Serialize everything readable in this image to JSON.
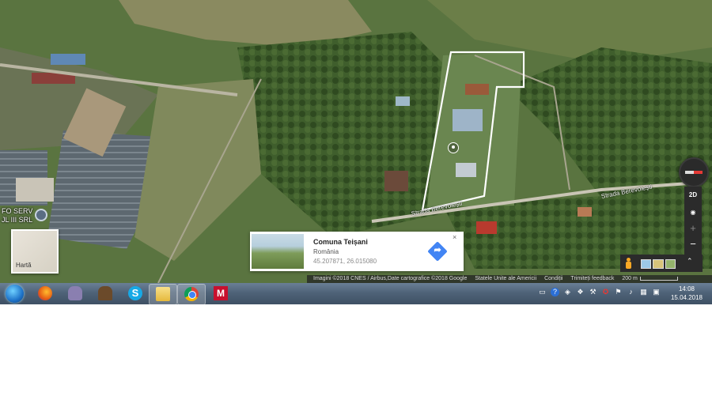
{
  "map": {
    "place_label_line1": "FO SERV",
    "place_label_line2": "JL III SRL",
    "street_1": "Strada Berevoiești",
    "street_2": "Strada Berevoiești",
    "map_type_label": "Hartă"
  },
  "info_card": {
    "title": "Comuna Teișani",
    "country": "România",
    "coordinates": "45.207871, 26.015080",
    "close_glyph": "×",
    "directions_glyph": "➦"
  },
  "controls": {
    "view_mode": "2D",
    "zoom_in": "+",
    "zoom_out": "−",
    "expand": "⌃"
  },
  "attribution": {
    "imagery": "Imagini ©2018 CNES / Airbus,Date cartografice ©2018 Google",
    "region": "Statele Unite ale Americii",
    "terms": "Condiții",
    "feedback": "Trimiteți feedback",
    "scale": "200 m"
  },
  "taskbar": {
    "apps": [
      "start",
      "firefox",
      "gimp",
      "game",
      "skype",
      "explorer",
      "chrome",
      "mcafee"
    ],
    "skype_glyph": "S",
    "mcafee_glyph": "M",
    "clock_time": "14:08",
    "clock_date": "15.04.2018"
  },
  "colors": {
    "accent": "#4285f4",
    "taskbar": "#4f6378"
  }
}
